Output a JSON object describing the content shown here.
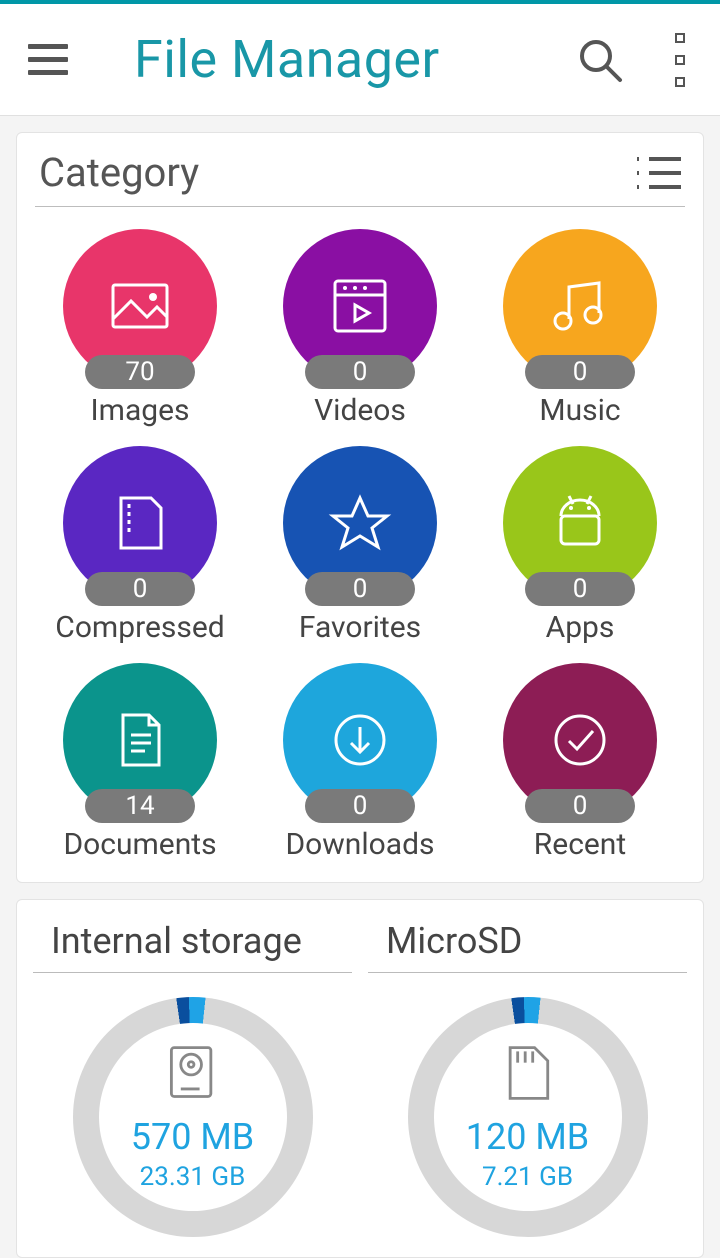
{
  "header": {
    "title": "File Manager"
  },
  "category_section": {
    "title": "Category"
  },
  "categories": [
    {
      "label": "Images",
      "count": "70",
      "color": "#e8356a",
      "icon": "image"
    },
    {
      "label": "Videos",
      "count": "0",
      "color": "#8a0fa3",
      "icon": "video"
    },
    {
      "label": "Music",
      "count": "0",
      "color": "#f7a61e",
      "icon": "music"
    },
    {
      "label": "Compressed",
      "count": "0",
      "color": "#5a27c2",
      "icon": "zip"
    },
    {
      "label": "Favorites",
      "count": "0",
      "color": "#1753b3",
      "icon": "star"
    },
    {
      "label": "Apps",
      "count": "0",
      "color": "#99c61a",
      "icon": "android"
    },
    {
      "label": "Documents",
      "count": "14",
      "color": "#0b948c",
      "icon": "doc"
    },
    {
      "label": "Downloads",
      "count": "0",
      "color": "#1ea6dc",
      "icon": "download"
    },
    {
      "label": "Recent",
      "count": "0",
      "color": "#8d1d55",
      "icon": "check"
    }
  ],
  "storage": [
    {
      "title": "Internal storage",
      "used": "570 MB",
      "total": "23.31 GB",
      "icon": "hdd"
    },
    {
      "title": "MicroSD",
      "used": "120 MB",
      "total": "7.21 GB",
      "icon": "sd"
    }
  ]
}
